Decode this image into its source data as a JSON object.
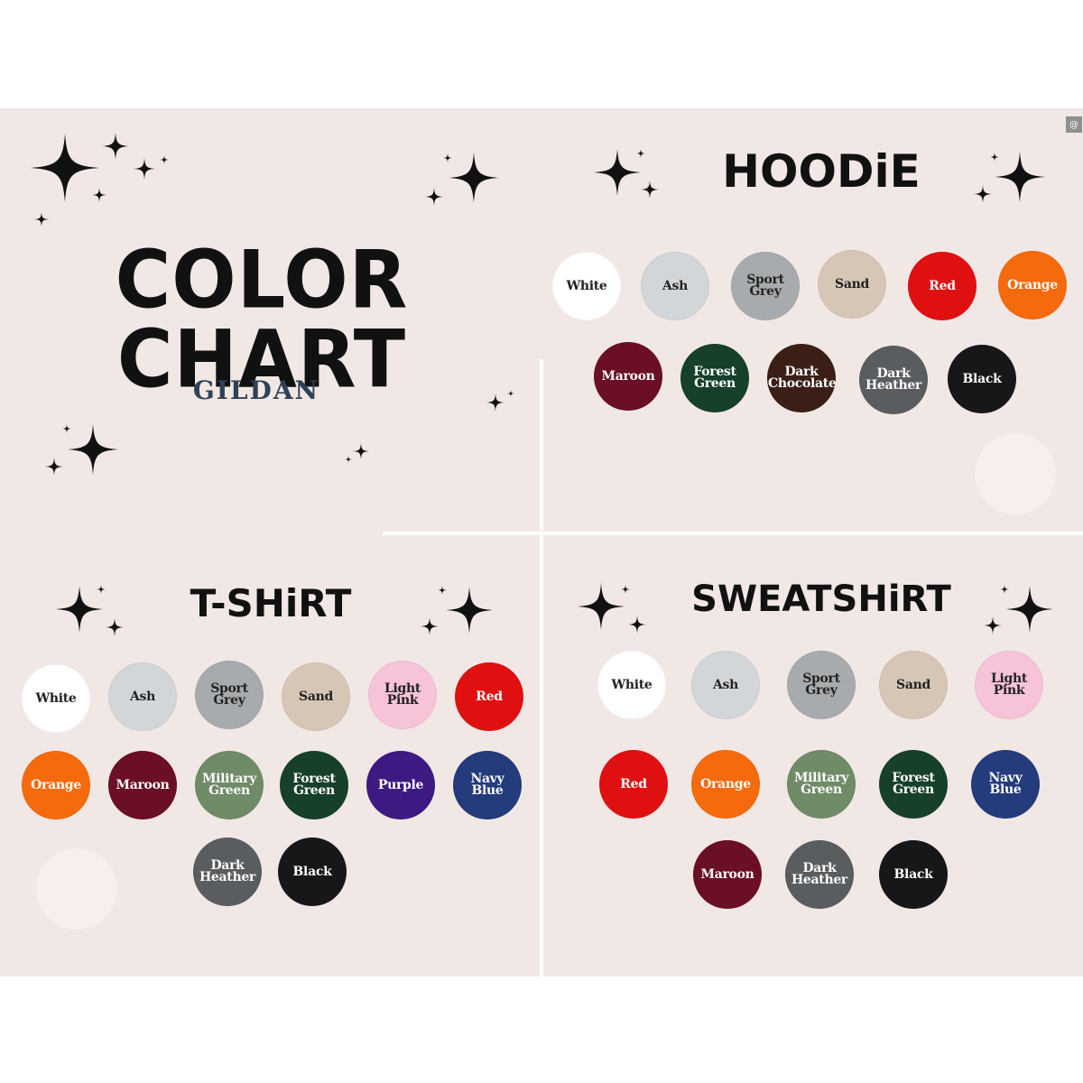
{
  "title": "COLOR CHART",
  "brand": "GILDAN",
  "watermark": "@",
  "colors": {
    "White": "#ffffff",
    "Ash": "#d3d6d8",
    "Sport Grey": "#a8abad",
    "Sand": "#d6c6b6",
    "Red": "#e01010",
    "Orange": "#f56a0c",
    "Maroon": "#6a0f25",
    "Forest Green": "#16402a",
    "Dark Chocolate": "#3b1f17",
    "Dark Heather": "#5a5d60",
    "Black": "#17171a",
    "Light Pink": "#f6c3d9",
    "Military Green": "#6f8b67",
    "Purple": "#3c1a82",
    "Navy Blue": "#243b7c"
  },
  "hoodie": {
    "title": "HOODiE",
    "swatches": [
      {
        "line1": "White",
        "line2": "",
        "color_key": "White"
      },
      {
        "line1": "Ash",
        "line2": "",
        "color_key": "Ash"
      },
      {
        "line1": "Sport",
        "line2": "Grey",
        "color_key": "Sport Grey"
      },
      {
        "line1": "Sand",
        "line2": "",
        "color_key": "Sand"
      },
      {
        "line1": "Red",
        "line2": "",
        "color_key": "Red"
      },
      {
        "line1": "Orange",
        "line2": "",
        "color_key": "Orange"
      },
      {
        "line1": "Maroon",
        "line2": "",
        "color_key": "Maroon"
      },
      {
        "line1": "Forest",
        "line2": "Green",
        "color_key": "Forest Green"
      },
      {
        "line1": "Dark",
        "line2": "Chocolate",
        "color_key": "Dark Chocolate"
      },
      {
        "line1": "Dark",
        "line2": "Heather",
        "color_key": "Dark Heather"
      },
      {
        "line1": "Black",
        "line2": "",
        "color_key": "Black"
      }
    ]
  },
  "tshirt": {
    "title": "T-SHiRT",
    "swatches": [
      {
        "line1": "White",
        "line2": "",
        "color_key": "White"
      },
      {
        "line1": "Ash",
        "line2": "",
        "color_key": "Ash"
      },
      {
        "line1": "Sport",
        "line2": "Grey",
        "color_key": "Sport Grey"
      },
      {
        "line1": "Sand",
        "line2": "",
        "color_key": "Sand"
      },
      {
        "line1": "Light",
        "line2": "Pink",
        "color_key": "Light Pink"
      },
      {
        "line1": "Red",
        "line2": "",
        "color_key": "Red"
      },
      {
        "line1": "Orange",
        "line2": "",
        "color_key": "Orange"
      },
      {
        "line1": "Maroon",
        "line2": "",
        "color_key": "Maroon"
      },
      {
        "line1": "Military",
        "line2": "Green",
        "color_key": "Military Green"
      },
      {
        "line1": "Forest",
        "line2": "Green",
        "color_key": "Forest Green"
      },
      {
        "line1": "Purple",
        "line2": "",
        "color_key": "Purple"
      },
      {
        "line1": "Navy",
        "line2": "Blue",
        "color_key": "Navy Blue"
      },
      {
        "line1": "Dark",
        "line2": "Heather",
        "color_key": "Dark Heather"
      },
      {
        "line1": "Black",
        "line2": "",
        "color_key": "Black"
      }
    ]
  },
  "sweatshirt": {
    "title": "SWEATSHiRT",
    "swatches": [
      {
        "line1": "White",
        "line2": "",
        "color_key": "White"
      },
      {
        "line1": "Ash",
        "line2": "",
        "color_key": "Ash"
      },
      {
        "line1": "Sport",
        "line2": "Grey",
        "color_key": "Sport Grey"
      },
      {
        "line1": "Sand",
        "line2": "",
        "color_key": "Sand"
      },
      {
        "line1": "Light",
        "line2": "Pink",
        "color_key": "Light Pink"
      },
      {
        "line1": "Red",
        "line2": "",
        "color_key": "Red"
      },
      {
        "line1": "Orange",
        "line2": "",
        "color_key": "Orange"
      },
      {
        "line1": "Military",
        "line2": "Green",
        "color_key": "Military Green"
      },
      {
        "line1": "Forest",
        "line2": "Green",
        "color_key": "Forest Green"
      },
      {
        "line1": "Navy",
        "line2": "Blue",
        "color_key": "Navy Blue"
      },
      {
        "line1": "Maroon",
        "line2": "",
        "color_key": "Maroon"
      },
      {
        "line1": "Dark",
        "line2": "Heather",
        "color_key": "Dark Heather"
      },
      {
        "line1": "Black",
        "line2": "",
        "color_key": "Black"
      }
    ]
  }
}
